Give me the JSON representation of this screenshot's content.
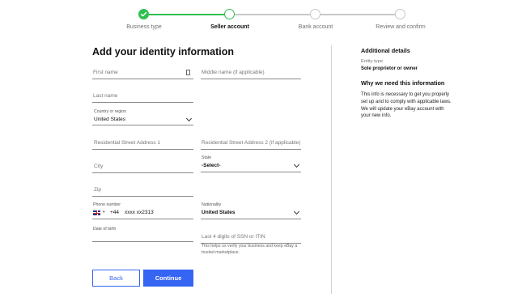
{
  "stepper": {
    "steps": [
      {
        "label": "Business type",
        "state": "complete"
      },
      {
        "label": "Seller account",
        "state": "active"
      },
      {
        "label": "Bank account",
        "state": "pending"
      },
      {
        "label": "Review and confirm",
        "state": "pending"
      }
    ],
    "colors": {
      "complete": "#2fbf4f",
      "pending": "#c7c7c7"
    }
  },
  "form": {
    "title": "Add your identity information",
    "first_name_placeholder": "First name",
    "middle_name_placeholder": "Middle name (if applicable)",
    "last_name_placeholder": "Last name",
    "country_label": "Country or region",
    "country_value": "United States",
    "address1_placeholder": "Residential Street Address 1",
    "address2_placeholder": "Residential Street Address 2 (if applicable)",
    "city_placeholder": "City",
    "state_label": "State",
    "state_value": "-Select-",
    "zip_placeholder": "Zip",
    "phone_label": "Phone number",
    "phone_code": "+44",
    "phone_value": "xxxx xx2313",
    "nationality_label": "Nationality",
    "nationality_value": "United States",
    "dob_label": "Date of birth",
    "ssn_placeholder": "Last 4 digits of SSN or ITIN",
    "ssn_help": "This helps us verify your business and keep eBay a trusted marketplace.",
    "back_label": "Back",
    "continue_label": "Continue",
    "accent_color": "#3665f3"
  },
  "sidebar": {
    "details_heading": "Additional details",
    "entity_label": "Entity type",
    "entity_value": "Sole proprietor or owner",
    "why_heading": "Why we need this information",
    "why_text": "This info is necessary to get you properly set up and to comply with applicable laws. We will update your eBay account with your new info."
  }
}
